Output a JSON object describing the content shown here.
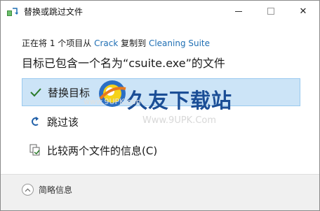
{
  "titlebar": {
    "title": "替换或跳过文件",
    "minimize_icon": "minimize-icon",
    "maximize_icon": "maximize-icon",
    "close_glyph": "✕"
  },
  "progress": {
    "prefix": "正在将 1 个项目从 ",
    "source": "Crack",
    "middle": " 复制到 ",
    "destination": "Cleaning Suite"
  },
  "headline": "目标已包含一个名为“csuite.exe”的文件",
  "options": {
    "replace": "替换目标",
    "skip": "跳过该",
    "compare": "比较两个文件的信息(C)"
  },
  "footer": {
    "details_label": "简略信息"
  },
  "watermark": {
    "brand": "久友下载站",
    "site_left": "www.9UPK.com",
    "site_right": "Www.9UPK.Com"
  },
  "colors": {
    "link": "#1f6fb4",
    "selection": "#cce4f7",
    "brand": "#1b4e96"
  }
}
